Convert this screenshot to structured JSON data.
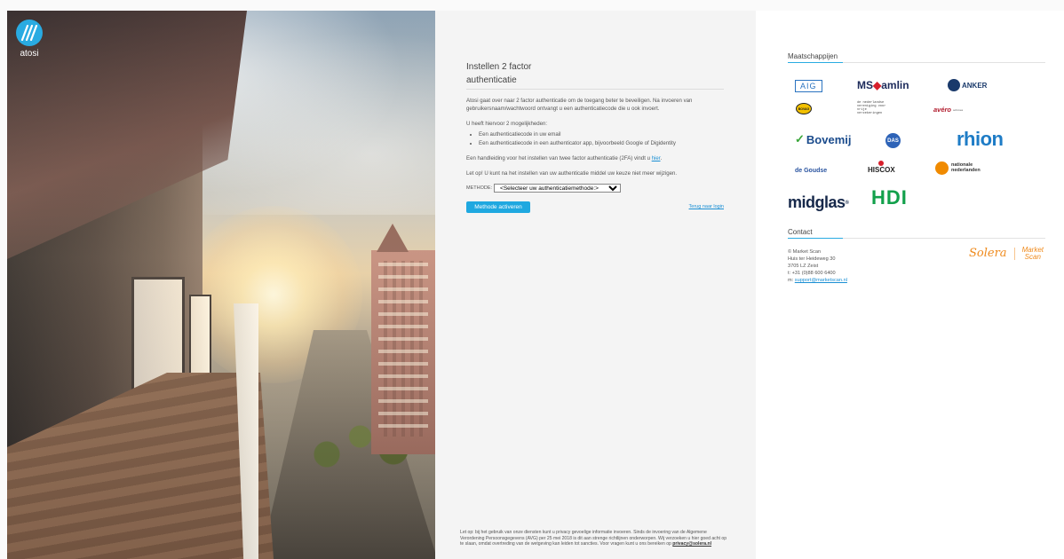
{
  "brand": {
    "logo_text": "atosi",
    "logo_glyph": "M"
  },
  "form": {
    "title": "Instellen 2 factor authenticatie",
    "intro": "Atosi gaat over naar 2 factor authenticatie om de toegang beter te beveiligen. Na invoeren van gebruikersnaam/wachtwoord ontvangt u een authenticatiecode die u ook invoert.",
    "options_intro": "U heeft hiervoor 2 mogelijkheden:",
    "options": [
      "Een authenticatiecode in uw email",
      "Een authenticatiecode in een authenticator app, bijvoorbeeld Google of Digidentity"
    ],
    "manual_text": "Een handleiding voor het instellen van twee factor authenticatie (2FA) vindt u ",
    "manual_link": "hier",
    "manual_end": ".",
    "warning": "Let op! U kunt na het instellen van uw authenticatie middel uw keuze niet meer wijzigen.",
    "method_label": "METHODE:",
    "method_selected": "<Selecteer uw authenticatiemethode:>",
    "activate_button": "Methode activeren",
    "back_link": "Terug naar login"
  },
  "privacy": {
    "text": "Let op: bij het gebruik van onze diensten kunt u privacy gevoelige informatie invoeren. Sinds de invoering van de Algemene Verordening Persoonsgegevens (AVG) per 25 mei 2018 is dit aan strenge richtlijnen onderworpen. Wij verzoeken u hier goed acht op te slaan, omdat overtreding van de wetgeving kan leiden tot sancties. Voor vragen kunt u ons bereiken op ",
    "email": "privacy@solera.nl"
  },
  "companies": {
    "title": "Maatschappijen",
    "aig": "AIG",
    "amlin_ms": "MS",
    "amlin_name": "amlin",
    "anker": "ANKER",
    "bovag": "BOVAG",
    "dnvv": "de nederlandse vereniging voor vrije verzekeringen",
    "avero": "avéro",
    "avero_sub": "achmea",
    "bovemij_check": "✓",
    "bovemij": "Bovemij",
    "das": "DAS",
    "rhion": "rhion",
    "goudse": "de Goudse",
    "hiscox": "HISCOX",
    "nn_line1": "nationale",
    "nn_line2": "nederlanden",
    "midglas": "midglas",
    "midglas_reg": "®",
    "hdi": "HDI"
  },
  "contact": {
    "title": "Contact",
    "company": "© Market Scan",
    "street": "Huis ter Heideweg 30",
    "city": "3705 LZ Zeist",
    "phone": "t: +31 (0)88 600 6400",
    "email_prefix": "m: ",
    "email": "support@marketscan.nl",
    "solera": "Solera",
    "market": "Market",
    "scan": "Scan"
  },
  "colors": {
    "accent": "#29abe2",
    "button": "#1fa8e0",
    "solera": "#ef8a1c"
  }
}
